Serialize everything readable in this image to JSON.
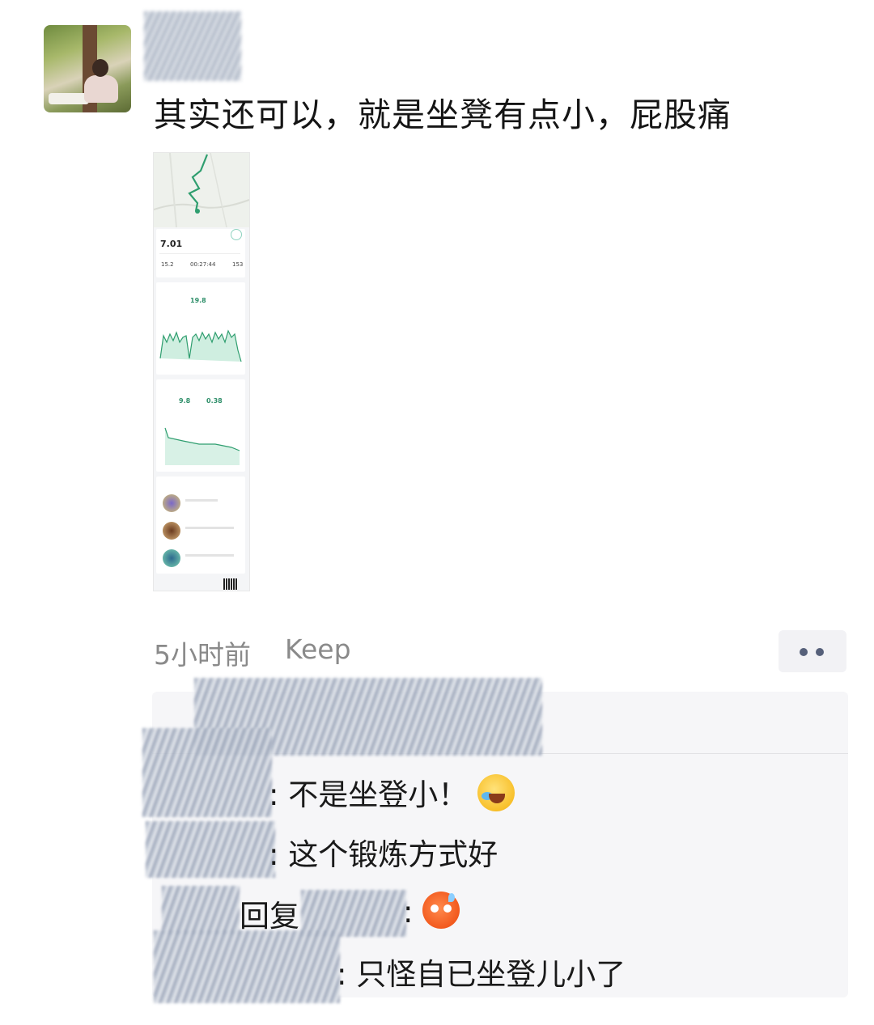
{
  "post": {
    "text": "其实还可以，就是坐凳有点小，屁股痛",
    "time": "5小时前",
    "source": "Keep"
  },
  "workout_thumbnail": {
    "distance": "7.01",
    "stats": [
      "15.2",
      "00:27:44",
      "153"
    ],
    "speed_value": "19.8",
    "pace_value_1": "9.8",
    "pace_value_2": "0.38"
  },
  "comments": [
    {
      "text": "不是坐登小！",
      "emoji": "laugh-cry"
    },
    {
      "text": "这个锻炼方式好"
    },
    {
      "reply_label": "回复",
      "emoji": "sweat"
    },
    {
      "text": "只怪自已坐登儿小了"
    }
  ],
  "colors": {
    "accent_green": "#2f8f6a",
    "meta_gray": "#8a8a8a",
    "comment_bg": "#f6f6f8"
  }
}
